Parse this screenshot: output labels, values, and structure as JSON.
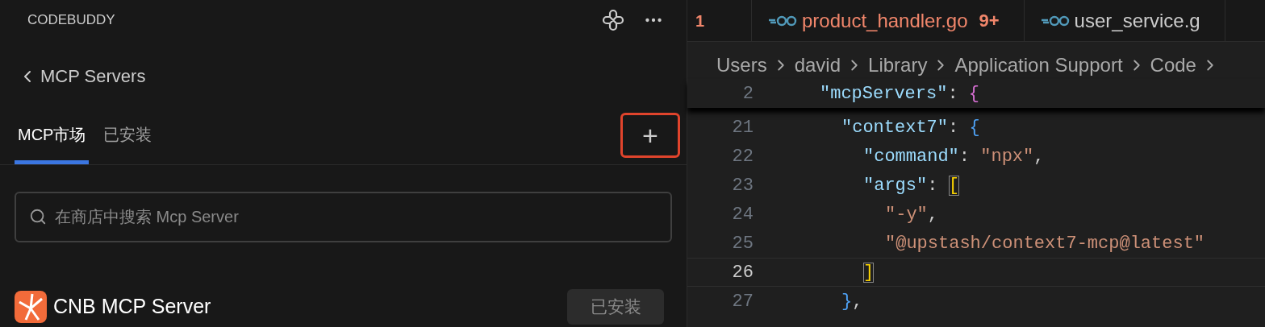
{
  "sidebar": {
    "title": "CODEBUDDY",
    "back_label": "MCP Servers",
    "tabs": [
      {
        "label": "MCP市场",
        "selected": true
      },
      {
        "label": "已安装",
        "selected": false
      }
    ],
    "add_button": {
      "label": "+",
      "highlighted": true
    },
    "search": {
      "placeholder": "在商店中搜索 Mcp Server"
    },
    "servers": [
      {
        "name": "CNB MCP Server",
        "action": "已安装",
        "installed": true
      }
    ]
  },
  "editor": {
    "tabs": [
      {
        "kind": "counter",
        "label": "1",
        "error": true
      },
      {
        "kind": "file",
        "label": "product_handler.go",
        "badge": "9+",
        "error": true
      },
      {
        "kind": "file",
        "label": "user_service.g",
        "error": false
      }
    ],
    "breadcrumbs": [
      "Users",
      "david",
      "Library",
      "Application Support",
      "Code"
    ],
    "sticky_lines": [
      {
        "number": "2",
        "current": false,
        "tokens": [
          {
            "kind": "key",
            "text": "\"mcpServers\""
          },
          {
            "kind": "punct",
            "text": ": "
          },
          {
            "kind": "brace-outer",
            "text": "{"
          }
        ]
      }
    ],
    "lines": [
      {
        "number": "21",
        "current": false,
        "tokens": [
          {
            "kind": "key",
            "text": "\"context7\""
          },
          {
            "kind": "punct",
            "text": ": "
          },
          {
            "kind": "brace",
            "text": "{"
          }
        ],
        "children": [
          {
            "number": "22",
            "current": false,
            "tokens": [
              {
                "kind": "key",
                "text": "\"command\""
              },
              {
                "kind": "punct",
                "text": ": "
              },
              {
                "kind": "string",
                "text": "\"npx\""
              },
              {
                "kind": "punct",
                "text": ","
              }
            ]
          },
          {
            "number": "23",
            "current": false,
            "tokens": [
              {
                "kind": "key",
                "text": "\"args\""
              },
              {
                "kind": "punct",
                "text": ": "
              },
              {
                "kind": "bracket-match",
                "text": "["
              }
            ],
            "children": [
              {
                "number": "24",
                "current": false,
                "tokens": [
                  {
                    "kind": "string",
                    "text": "\"-y\""
                  },
                  {
                    "kind": "punct",
                    "text": ","
                  }
                ]
              },
              {
                "number": "25",
                "current": false,
                "tokens": [
                  {
                    "kind": "string",
                    "text": "\"@upstash/context7-mcp@latest\""
                  }
                ]
              }
            ]
          },
          {
            "number": "26",
            "current": true,
            "tokens": [
              {
                "kind": "bracket-match",
                "text": "]"
              }
            ]
          }
        ]
      },
      {
        "number": "27",
        "current": false,
        "tokens": [
          {
            "kind": "brace",
            "text": "}"
          },
          {
            "kind": "punct",
            "text": ","
          }
        ]
      }
    ]
  }
}
